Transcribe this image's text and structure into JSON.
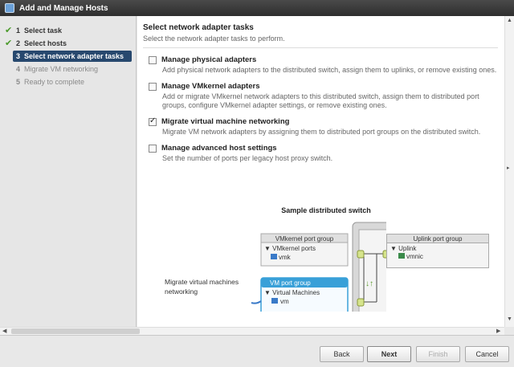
{
  "window": {
    "title": "Add and Manage Hosts"
  },
  "steps": [
    {
      "num": "1",
      "label": "Select task",
      "state": "done"
    },
    {
      "num": "2",
      "label": "Select hosts",
      "state": "done"
    },
    {
      "num": "3",
      "label": "Select network adapter tasks",
      "state": "active"
    },
    {
      "num": "4",
      "label": "Migrate VM networking",
      "state": "disabled"
    },
    {
      "num": "5",
      "label": "Ready to complete",
      "state": "disabled"
    }
  ],
  "main": {
    "title": "Select network adapter tasks",
    "subtitle": "Select the network adapter tasks to perform.",
    "options": [
      {
        "label": "Manage physical adapters",
        "checked": false,
        "description": "Add physical network adapters to the distributed switch, assign them to uplinks, or remove existing ones."
      },
      {
        "label": "Manage VMkernel adapters",
        "checked": false,
        "description": "Add or migrate VMkernel network adapters to this distributed switch, assign them to distributed port groups, configure VMkernel adapter settings, or remove existing ones."
      },
      {
        "label": "Migrate virtual machine networking",
        "checked": true,
        "description": "Migrate VM network adapters by assigning them to distributed port groups on the distributed switch."
      },
      {
        "label": "Manage advanced host settings",
        "checked": false,
        "description": "Set the number of ports per legacy host proxy switch."
      }
    ]
  },
  "diagram": {
    "title": "Sample distributed switch",
    "vmkernel_group": {
      "header": "VMkernel port group",
      "item": "▼ VMkernel ports",
      "leaf": "vmk"
    },
    "vm_group": {
      "header": "VM port group",
      "item": "▼ Virtual Machines",
      "leaf": "vm"
    },
    "uplink_group": {
      "header": "Uplink port group",
      "item": "▼ Uplink",
      "leaf": "vmnic"
    },
    "annotation": "Migrate virtual machines networking",
    "colors": {
      "highlight": "#39a0d8",
      "port": "#d6e48c",
      "panel": "#e2e2e2"
    }
  },
  "footer": {
    "back": "Back",
    "next": "Next",
    "finish": "Finish",
    "cancel": "Cancel"
  }
}
